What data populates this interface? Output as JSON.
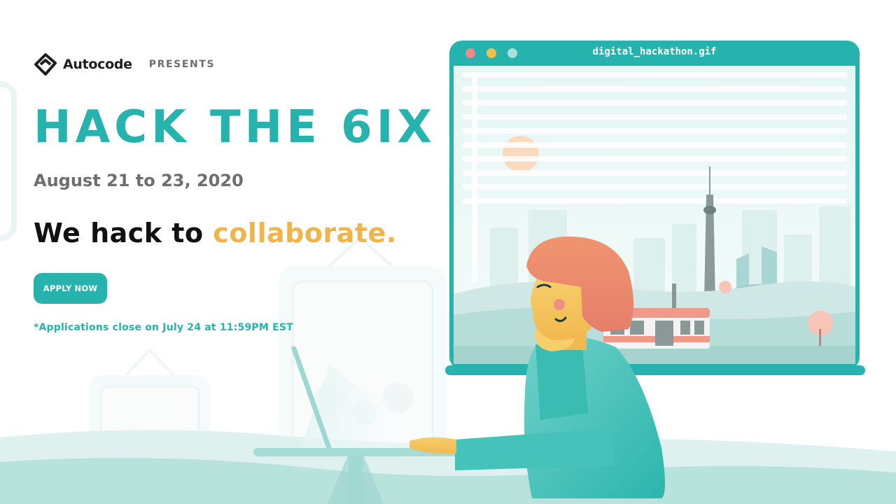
{
  "brand": {
    "name": "Autocode",
    "presents": "PRESENTS"
  },
  "hero": {
    "title": "HACK THE 6IX",
    "dates": "August 21 to 23, 2020",
    "tagline_prefix": "We hack to ",
    "tagline_accent": "collaborate."
  },
  "cta": {
    "apply_label": "APPLY NOW"
  },
  "note": "*Applications close on July 24 at 11:59PM EST",
  "illustration": {
    "window_title": "digital_hackathon.gif"
  },
  "colors": {
    "teal": "#26b3ad",
    "gold": "#f0b44a",
    "dark_text": "#111111",
    "gray_text": "#6e6e6e",
    "window_dot_red": "#f08a8a",
    "window_dot_yellow": "#f4c04a",
    "window_dot_mint": "#a8e0dc"
  }
}
